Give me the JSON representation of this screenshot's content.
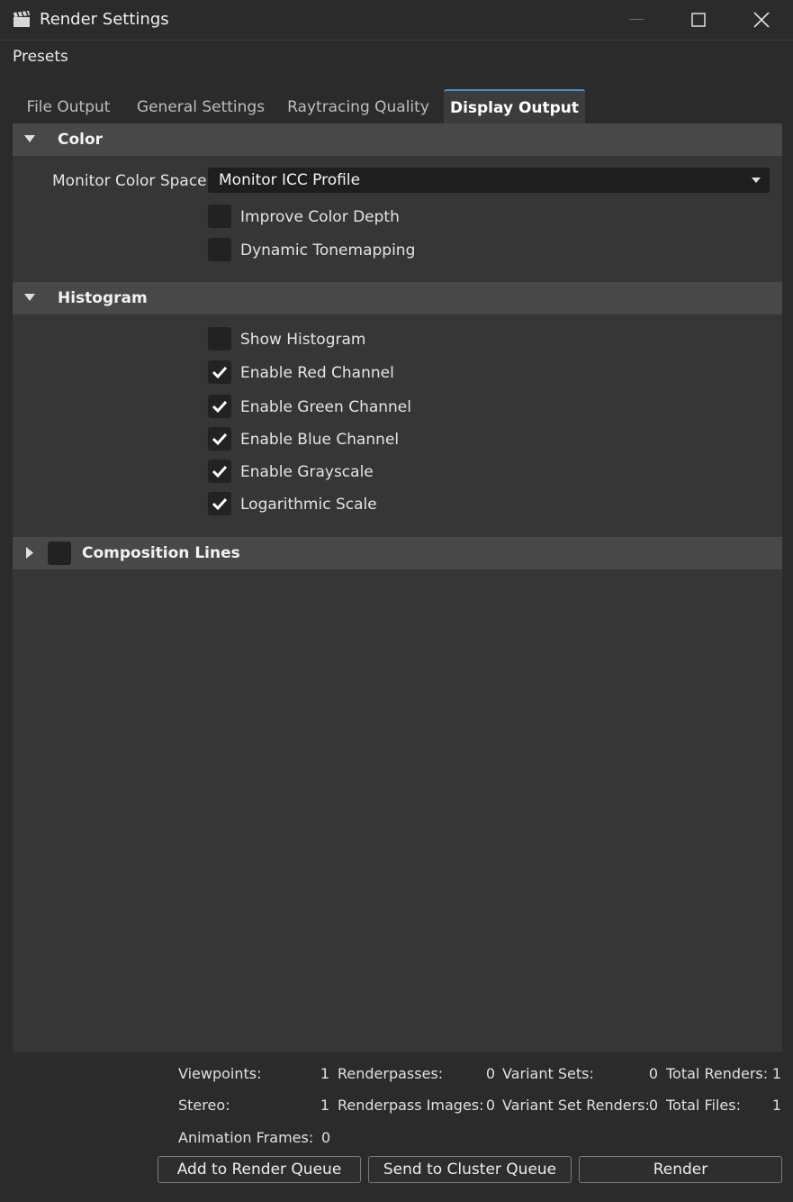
{
  "window": {
    "title": "Render Settings",
    "icon": "clapperboard-icon",
    "controls": [
      "minimize-icon",
      "maximize-icon",
      "close-icon"
    ]
  },
  "menu": {
    "presets": "Presets"
  },
  "tabs": [
    {
      "label": "File Output",
      "active": false
    },
    {
      "label": "General Settings",
      "active": false
    },
    {
      "label": "Raytracing Quality",
      "active": false
    },
    {
      "label": "Display Output",
      "active": true
    }
  ],
  "color_section": {
    "title": "Color",
    "expanded": true,
    "monitor_color_space_label": "Monitor Color Space",
    "monitor_color_space_value": "Monitor ICC Profile",
    "options": [
      {
        "label": "Improve Color Depth",
        "checked": false
      },
      {
        "label": "Dynamic Tonemapping",
        "checked": false
      }
    ]
  },
  "histogram_section": {
    "title": "Histogram",
    "expanded": true,
    "options": [
      {
        "label": "Show Histogram",
        "checked": false
      },
      {
        "label": "Enable Red Channel",
        "checked": true
      },
      {
        "label": "Enable Green Channel",
        "checked": true
      },
      {
        "label": "Enable Blue Channel",
        "checked": true
      },
      {
        "label": "Enable Grayscale",
        "checked": true
      },
      {
        "label": "Logarithmic Scale",
        "checked": true
      }
    ]
  },
  "composition_section": {
    "title": "Composition Lines",
    "expanded": false,
    "checked": false
  },
  "stats": {
    "viewpoints_label": "Viewpoints:",
    "viewpoints": "1",
    "renderpasses_label": "Renderpasses:",
    "renderpasses": "0",
    "variant_sets_label": "Variant Sets:",
    "variant_sets": "0",
    "total_renders_label": "Total Renders:",
    "total_renders": "1",
    "stereo_label": "Stereo:",
    "stereo": "1",
    "renderpass_images_label": "Renderpass Images:",
    "renderpass_images": "0",
    "variant_set_renders_label": "Variant Set Renders:",
    "variant_set_renders": "0",
    "total_files_label": "Total Files:",
    "total_files": "1",
    "animation_frames_label": "Animation Frames:",
    "animation_frames": "0"
  },
  "buttons": {
    "add_to_render_queue": "Add to Render Queue",
    "send_to_cluster_queue": "Send to Cluster Queue",
    "render": "Render"
  },
  "colors": {
    "background": "#2b2b2b",
    "panel": "#363636",
    "section_header": "#484848",
    "active_tab_accent": "#4a90c8"
  }
}
